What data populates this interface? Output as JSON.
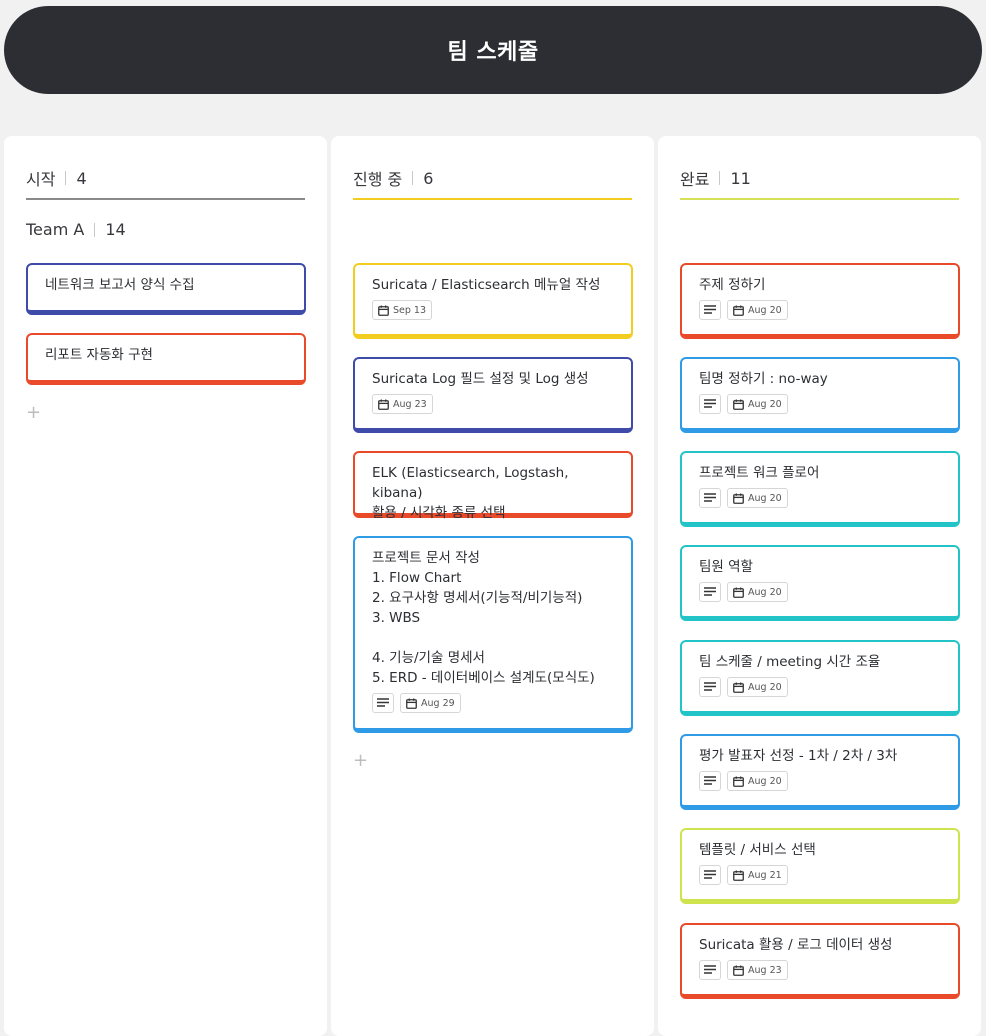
{
  "app": {
    "title": "팀 스케줄"
  },
  "icons": {
    "description": "lines-icon",
    "date": "calendar-icon",
    "add": "plus-icon"
  },
  "colors": {
    "header_bg": "#2c2e33",
    "start_line": "#8a8a8a",
    "progress_line": "#f2cd1f",
    "done_line": "#d4e157",
    "indigo": "#3f4ba8",
    "red": "#e84a2a",
    "yellow": "#f2cd1f",
    "blue": "#2f9be6",
    "cyan": "#22c4c8",
    "lime": "#cfe34f"
  },
  "columns": [
    {
      "name": "시작",
      "count": "4",
      "group": {
        "name": "Team A",
        "count": "14"
      },
      "cards": [
        {
          "title": "네트워크 보고서 양식 수집",
          "color": "indigo",
          "has_desc": false,
          "date": ""
        },
        {
          "title": "리포트 자동화 구현",
          "color": "red",
          "has_desc": false,
          "date": ""
        }
      ],
      "add_label": "+"
    },
    {
      "name": "진행 중",
      "count": "6",
      "cards": [
        {
          "title": "Suricata / Elasticsearch 메뉴얼 작성",
          "color": "yellow",
          "has_desc": false,
          "date": "Sep 13"
        },
        {
          "title": "Suricata Log 필드 설정 및  Log 생성",
          "color": "indigo",
          "has_desc": false,
          "date": "Aug 23"
        },
        {
          "title": "ELK (Elasticsearch, Logstash, kibana)\n활용 / 시각화 종류 선택",
          "color": "red",
          "has_desc": false,
          "date": ""
        },
        {
          "title": "프로젝트 문서 작성\n1. Flow Chart\n2. 요구사항 명세서(기능적/비기능적)\n3. WBS\n\n4. 기능/기술 명세서\n5. ERD - 데이터베이스 설계도(모식도)",
          "color": "blue",
          "has_desc": true,
          "date": "Aug 29"
        }
      ],
      "add_label": "+"
    },
    {
      "name": "완료",
      "count": "11",
      "cards": [
        {
          "title": "주제 정하기",
          "color": "red",
          "has_desc": true,
          "date": "Aug 20"
        },
        {
          "title": "팀명 정하기 : no-way",
          "color": "blue",
          "has_desc": true,
          "date": "Aug 20"
        },
        {
          "title": "프로젝트 워크 플로어",
          "color": "cyan",
          "has_desc": true,
          "date": "Aug 20"
        },
        {
          "title": "팀원 역할",
          "color": "cyan",
          "has_desc": true,
          "date": "Aug 20"
        },
        {
          "title": "팀 스케줄 / meeting 시간 조율",
          "color": "cyan",
          "has_desc": true,
          "date": "Aug 20"
        },
        {
          "title": "평가 발표자 선정 - 1차 / 2차 / 3차",
          "color": "blue",
          "has_desc": true,
          "date": "Aug 20"
        },
        {
          "title": "템플릿 / 서비스 선택",
          "color": "lime",
          "has_desc": true,
          "date": "Aug 21"
        },
        {
          "title": "Suricata 활용 / 로그 데이터 생성",
          "color": "red",
          "has_desc": true,
          "date": "Aug 23"
        }
      ]
    }
  ]
}
